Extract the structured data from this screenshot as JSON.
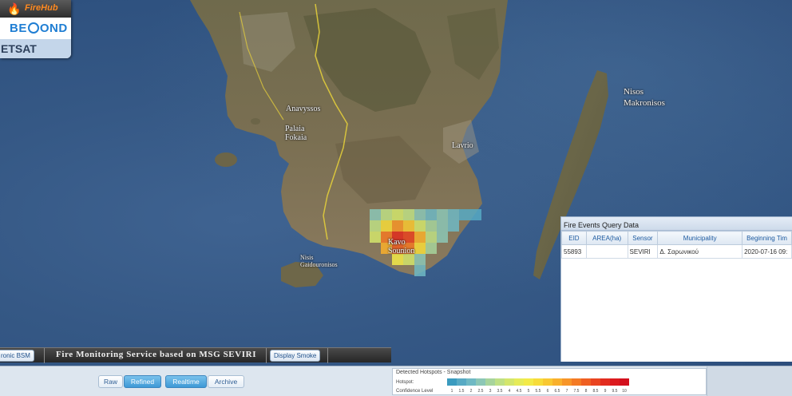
{
  "logo": {
    "firehub": "FireHub",
    "beyond": "BE ND",
    "noa": "ETSAT"
  },
  "map": {
    "places": {
      "anavyssos": "Anavyssos",
      "palaia_fokaia": "Palaia\nFokaia",
      "lavrio": "Lavrio",
      "nisos_makronisos": "Nisos\nMakronisos",
      "nisis_gaidouronisos": "Nisis\nGaidouronisos",
      "kavo_sounion": "Kavo\nSounion"
    }
  },
  "fire_panel": {
    "title": "Fire Events Query Data",
    "columns": [
      "EID",
      "AREA(ha)",
      "Sensor",
      "Municipality",
      "Beginning Tim"
    ],
    "rows": [
      {
        "eid": "55893",
        "area": "",
        "sensor": "SEVIRI",
        "municipality": "Δ. Σαρωνικού",
        "beginning": "2020-07-16 09:"
      }
    ]
  },
  "service_bar": {
    "left_button": "ronic BSM",
    "title": "Fire Monitoring Service based on MSG SEVIRI",
    "smoke_button": "Display Smoke"
  },
  "controls": {
    "raw": "Raw",
    "refined": "Refined",
    "realtime": "Realtime",
    "archive": "Archive"
  },
  "legend": {
    "title": "Detected Hotspots - Snapshot",
    "row1_label": "Hotspot:",
    "row2_label": "Confidence Level",
    "levels": [
      "1",
      "1.5",
      "2",
      "2.5",
      "3",
      "3.5",
      "4",
      "4.5",
      "5",
      "5.5",
      "6",
      "6.5",
      "7",
      "7.5",
      "8",
      "8.5",
      "9",
      "9.5",
      "10"
    ],
    "colors": [
      "#3a9bbf",
      "#57aac4",
      "#6fb9c4",
      "#8cc7b6",
      "#a7d49c",
      "#bfe085",
      "#d4e66c",
      "#e6eb58",
      "#f3ea48",
      "#f7dc3a",
      "#f9c832",
      "#f9b02c",
      "#f79528",
      "#f47a24",
      "#ef5f22",
      "#e94420",
      "#e22c1f",
      "#dc1a1e",
      "#d3101d"
    ]
  },
  "colors": {
    "refined_on": "#3d98d6",
    "panel_header": "#1d5aa0"
  }
}
